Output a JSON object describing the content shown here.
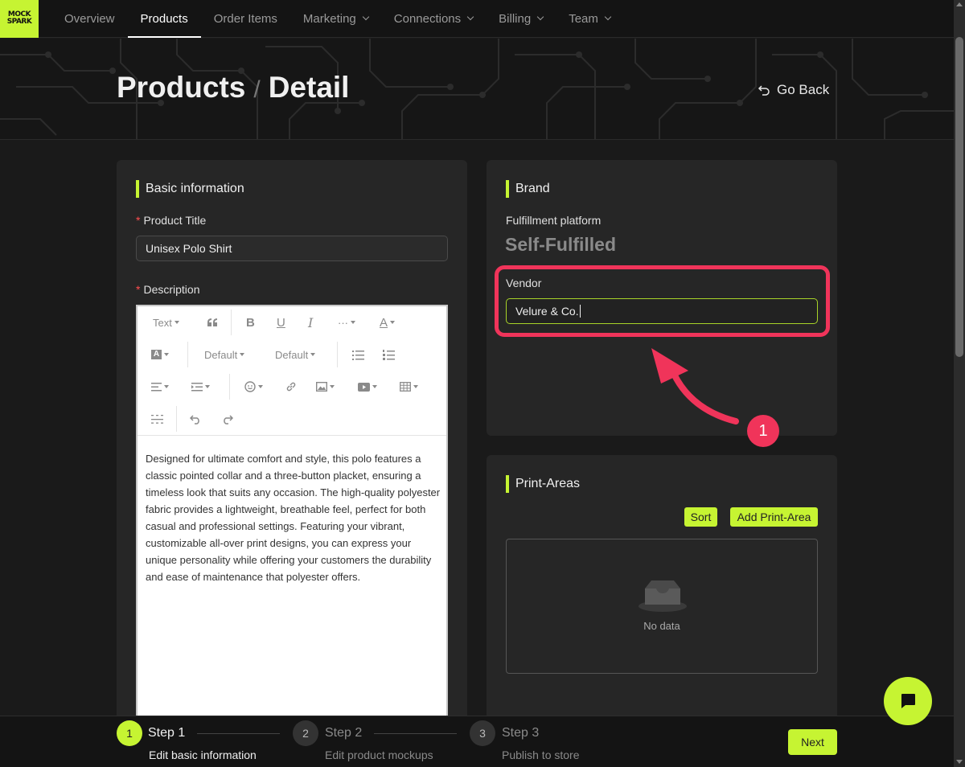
{
  "logo": {
    "line1": "MOCK",
    "line2": "SPARK"
  },
  "nav": {
    "items": [
      {
        "label": "Overview",
        "dropdown": false
      },
      {
        "label": "Products",
        "dropdown": false,
        "active": true
      },
      {
        "label": "Order Items",
        "dropdown": false
      },
      {
        "label": "Marketing",
        "dropdown": true
      },
      {
        "label": "Connections",
        "dropdown": true
      },
      {
        "label": "Billing",
        "dropdown": true
      },
      {
        "label": "Team",
        "dropdown": true
      }
    ]
  },
  "header": {
    "crumb1": "Products",
    "separator": "/",
    "crumb2": "Detail",
    "go_back": "Go Back"
  },
  "basic": {
    "title": "Basic information",
    "product_title_label": "Product Title",
    "product_title_value": "Unisex Polo Shirt",
    "description_label": "Description",
    "toolbar": {
      "text_style": "Text",
      "font_family": "Default",
      "font_size": "Default"
    },
    "description": "Designed for ultimate comfort and style, this polo features a classic pointed collar and a three-button placket, ensuring a timeless look that suits any occasion. The high-quality polyester fabric provides a lightweight, breathable feel, perfect for both casual and professional settings. Featuring your vibrant, customizable all-over print designs, you can express your unique personality while offering your customers the durability and ease of maintenance that polyester offers."
  },
  "brand": {
    "title": "Brand",
    "platform_label": "Fulfillment platform",
    "platform_value": "Self-Fulfilled",
    "vendor_label": "Vendor",
    "vendor_value": "Velure & Co."
  },
  "annotation": {
    "number": "1",
    "color": "#f0345a"
  },
  "print_areas": {
    "title": "Print-Areas",
    "sort_label": "Sort",
    "add_label": "Add Print-Area",
    "empty_text": "No data"
  },
  "steps": [
    {
      "number": "1",
      "title": "Step 1",
      "desc": "Edit basic information",
      "active": true
    },
    {
      "number": "2",
      "title": "Step 2",
      "desc": "Edit product mockups",
      "active": false
    },
    {
      "number": "3",
      "title": "Step 3",
      "desc": "Publish to store",
      "active": false
    }
  ],
  "next_label": "Next",
  "colors": {
    "accent": "#c6f432",
    "annotation": "#f0345a",
    "background": "#1a1a1a",
    "card": "#262626"
  }
}
